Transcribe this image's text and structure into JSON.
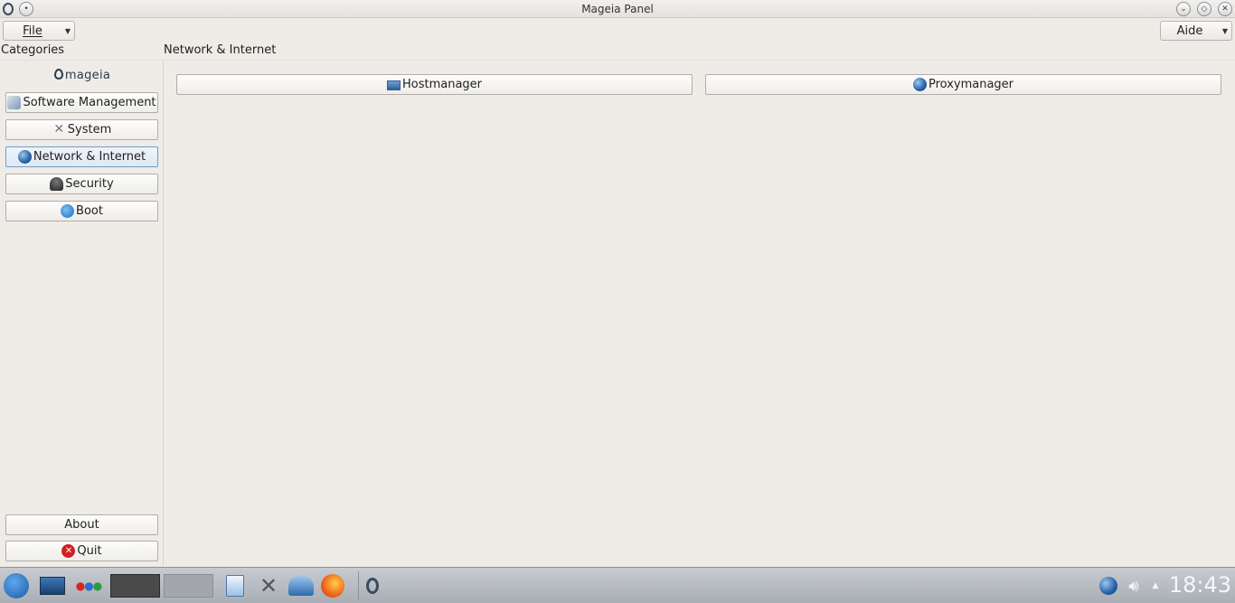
{
  "window": {
    "title": "Mageia Panel"
  },
  "menubar": {
    "file_label": "File",
    "help_label": "Aide"
  },
  "headers": {
    "categories": "Categories",
    "section": "Network & Internet"
  },
  "sidebar": {
    "logo_text": "mageia",
    "items": [
      {
        "label": "Software Management",
        "icon": "software-icon"
      },
      {
        "label": "System",
        "icon": "tools-icon"
      },
      {
        "label": "Network & Internet",
        "icon": "globe-icon",
        "active": true
      },
      {
        "label": "Security",
        "icon": "lock-icon"
      },
      {
        "label": "Boot",
        "icon": "boot-icon"
      }
    ],
    "about_label": "About",
    "quit_label": "Quit"
  },
  "main": {
    "buttons": [
      {
        "label": "Hostmanager",
        "icon": "monitor-icon"
      },
      {
        "label": "Proxymanager",
        "icon": "globe-icon"
      }
    ]
  },
  "taskbar": {
    "clock": "18:43"
  },
  "colors": {
    "accent": "#6e9ec7",
    "window_bg": "#efebe7",
    "taskbar": "#b4b9bf"
  }
}
